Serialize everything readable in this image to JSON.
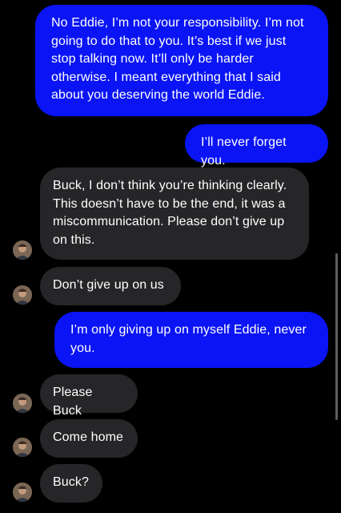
{
  "conversation": {
    "messages": [
      {
        "direction": "outgoing",
        "text": "No Eddie, I’m not your responsibility. I’m not going to do that to you. It’s best if we just stop talking now. It’ll only be harder otherwise. I meant everything that I said about you deserving the world Eddie."
      },
      {
        "direction": "outgoing",
        "text": "I’ll never forget you."
      },
      {
        "direction": "incoming",
        "text": "Buck, I don’t think you’re thinking clearly. This doesn’t have to be the end, it was a miscommunication. Please don’t give up on this."
      },
      {
        "direction": "incoming",
        "text": "Don’t give up on us"
      },
      {
        "direction": "outgoing",
        "text": "I’m only giving up on myself Eddie, never you."
      },
      {
        "direction": "incoming",
        "text": "Please Buck"
      },
      {
        "direction": "incoming",
        "text": "Come home"
      },
      {
        "direction": "incoming",
        "text": "Buck?"
      }
    ]
  },
  "colors": {
    "background": "#000000",
    "outgoing_bubble": "#0a14f5",
    "incoming_bubble": "#262629",
    "text": "#ffffff"
  },
  "icons": {
    "contact_avatar": "contact-avatar-photo"
  }
}
